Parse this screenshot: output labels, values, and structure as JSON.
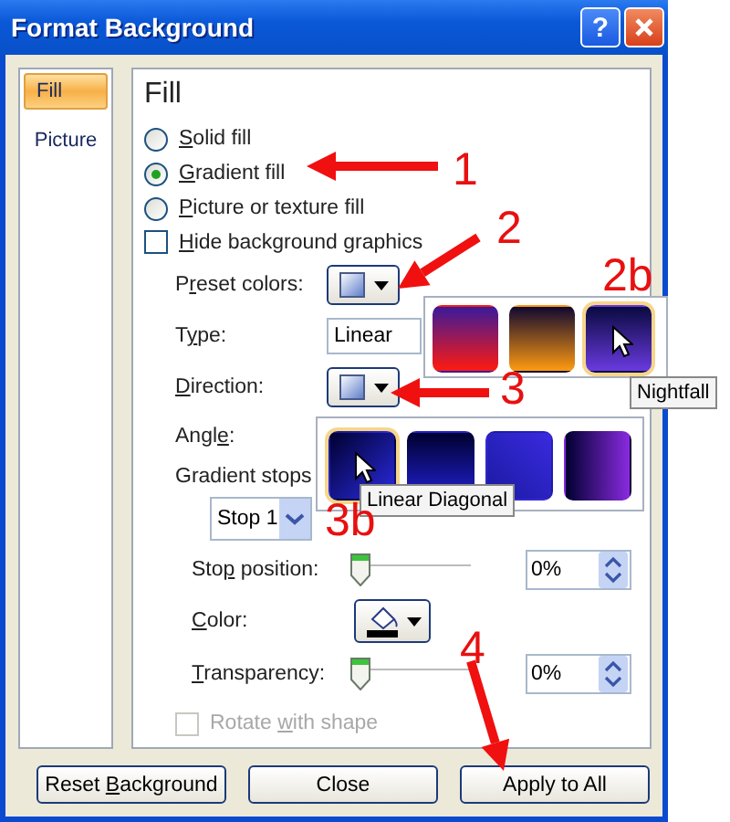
{
  "window": {
    "title": "Format Background",
    "help": "?"
  },
  "sidebar": {
    "items": [
      {
        "label": "Fill",
        "selected": true
      },
      {
        "label": "Picture",
        "selected": false
      }
    ]
  },
  "panel": {
    "heading": "Fill",
    "fill_options": [
      {
        "label": "Solid fill",
        "selected": false
      },
      {
        "label": "Gradient fill",
        "selected": true
      },
      {
        "label": "Picture or texture fill",
        "selected": false
      }
    ],
    "hide_background": {
      "label": "Hide background graphics",
      "checked": false
    },
    "preset_colors": {
      "label": "Preset colors:"
    },
    "type": {
      "label": "Type:",
      "value": "Linear"
    },
    "direction": {
      "label": "Direction:"
    },
    "angle": {
      "label": "Angle:"
    },
    "gradient_stops": {
      "label": "Gradient stops",
      "value": "Stop 1"
    },
    "stop_position": {
      "label": "Stop position:",
      "level": 0,
      "value": "0%"
    },
    "color": {
      "label": "Color:"
    },
    "transparency": {
      "label": "Transparency:",
      "level": 0,
      "value": "0%"
    },
    "rotate_with_shape": {
      "label": "Rotate with shape",
      "checked": false,
      "disabled": true
    }
  },
  "preset_gallery": {
    "swatches": [
      {
        "selected": false
      },
      {
        "selected": false
      },
      {
        "selected": true
      }
    ],
    "tooltip": "Nightfall"
  },
  "direction_gallery": {
    "swatches": [
      {
        "selected": true
      },
      {
        "selected": false
      },
      {
        "selected": false
      },
      {
        "selected": false
      }
    ],
    "tooltip": "Linear Diagonal"
  },
  "buttons": [
    {
      "label": "Reset Background"
    },
    {
      "label": "Close"
    },
    {
      "label": "Apply to All"
    }
  ],
  "annotations": [
    {
      "label": "1",
      "kind": "arrow"
    },
    {
      "label": "2",
      "kind": "arrow"
    },
    {
      "label": "2b",
      "kind": "label"
    },
    {
      "label": "3",
      "kind": "arrow"
    },
    {
      "label": "3b",
      "kind": "label"
    },
    {
      "label": "4",
      "kind": "arrow"
    }
  ]
}
